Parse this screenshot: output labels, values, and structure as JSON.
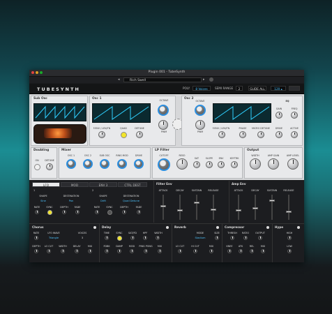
{
  "window": {
    "title": "Plugin 001 - TubeSynth"
  },
  "preset": {
    "name": "Rich Swell"
  },
  "toolbar": {
    "logo": "TUBESYNTH",
    "poly_label": "POLY",
    "voices": "8 Voices",
    "semi_range_label": "SEMI RANGE",
    "semi_range_value": "2",
    "glide_label": "GLIDE ALL",
    "bpm": "120 ▴"
  },
  "sections": {
    "sub_osc": "Sub Osc",
    "osc1": "Osc 1",
    "osc2": "Osc 2",
    "doubling": "Doubling",
    "mixer": "Mixer",
    "lp_filter": "LP Filter",
    "output": "Output",
    "eq": "EQ"
  },
  "osc1": {
    "octave": "OCTAVE",
    "pwm": "PWM",
    "fenv": "F.ENV / LEN/TN",
    "quad": "QUAD",
    "detune": "DETUNE"
  },
  "osc2": {
    "octave": "OCTAVE",
    "pwm": "PWM",
    "fenv": "F.ENV / LEN/TN",
    "phase": "PHASE",
    "micro": "MICRO DETUNE",
    "drive": "DRIVE",
    "active": "ACTIVE"
  },
  "eq": {
    "gain": "GAIN",
    "freq": "FREQ"
  },
  "doubling": {
    "on": "ON",
    "detune": "DETUNE"
  },
  "mixer": {
    "osc1": "OSC 1",
    "osc2": "OSC 2",
    "sub": "SUB OSC",
    "ringmod": "RING MOD",
    "drive": "DRIVE"
  },
  "filter": {
    "cutoff": "CUTOFF",
    "reso": "RESO",
    "sat": "SAT",
    "slope": "SLOPE",
    "env": "ENV",
    "keytrk": "KEYTRK"
  },
  "output": {
    "width": "WIDTH",
    "amp": "AMP GAIN",
    "level": "AMP LEVEL"
  },
  "mod_tabs": [
    "LFO",
    "MOD",
    "ENV 3",
    "CTRL DEST"
  ],
  "lfo1": {
    "num": "1",
    "shape": "SHAPE",
    "shape_val": "Sine",
    "dest": "DESTINATION",
    "dest_val": "Pan",
    "rate": "RATE",
    "sync": "SYNC",
    "depth": "DEPTH",
    "fade": "FADE"
  },
  "lfo2": {
    "num": "2",
    "shape": "SHAPE",
    "shape_val": "Drift",
    "dest": "DESTINATION",
    "dest_val": "Quad Detune",
    "rate": "RATE",
    "sync": "SYNC",
    "depth": "DEPTH",
    "fade": "FADE"
  },
  "filter_env": {
    "title": "Filter Env",
    "labels": [
      "ATTACK",
      "DECAY",
      "SUSTAIN",
      "RELEASE"
    ],
    "values": [
      0.55,
      0.35,
      0.7,
      0.4
    ]
  },
  "amp_env": {
    "title": "Amp Env",
    "labels": [
      "ATTACK",
      "DECAY",
      "SUSTAIN",
      "RELEASE"
    ],
    "values": [
      0.35,
      0.45,
      0.8,
      0.3
    ]
  },
  "chorus": {
    "title": "Chorus",
    "rate": "RATE",
    "lfo_wave": "LFO WAVE",
    "lfo_wave_val": "Triangle",
    "voices": "VOICES",
    "voices_val": "3",
    "depth": "DEPTH",
    "lo_cut": "LO CUT",
    "width": "WIDTH",
    "delay": "DELAY",
    "mix": "MIX"
  },
  "delay": {
    "title": "Delay",
    "time": "TIME",
    "sync": "SYNC",
    "sat": "SAT/FD",
    "hpf": "HPF",
    "width": "WIDTH",
    "fdbk": "FDBK",
    "damp": "DAMP",
    "mod": "MOD",
    "ping": "PING PONG",
    "mix": "MIX"
  },
  "reverb": {
    "title": "Reverb",
    "mode": "MODE",
    "mode_val": "Stadium",
    "size": "SIZE",
    "lo_cut": "LO CUT",
    "hi_cut": "HI CUT",
    "mix": "MIX"
  },
  "compressor": {
    "title": "Compressor",
    "thresh": "THRESH",
    "ratio": "RATIO",
    "output": "OUTPUT",
    "knee": "KNEE",
    "atk": "ATK",
    "rel": "REL",
    "mix": "MIX"
  },
  "hype": {
    "title": "Hype",
    "high": "HIGH",
    "low": "LOW"
  }
}
